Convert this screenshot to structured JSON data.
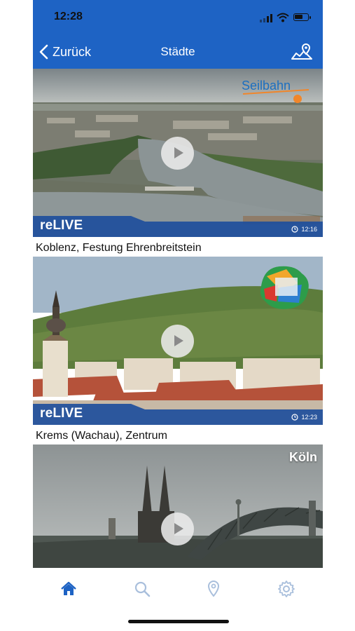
{
  "status_bar": {
    "time": "12:28"
  },
  "nav": {
    "back_label": "Zurück",
    "title": "Städte"
  },
  "colors": {
    "primary": "#1e63c4",
    "tab_inactive": "#a9bfdc"
  },
  "cams": [
    {
      "relive_label": "reLIVE",
      "time": "12:16",
      "caption": "Koblenz, Festung Ehrenbreitstein",
      "logo_text": "Seilbahn"
    },
    {
      "relive_label": "reLIVE",
      "time": "12:23",
      "caption": "Krems (Wachau), Zentrum"
    },
    {
      "city_label": "Köln"
    }
  ],
  "tabs": [
    {
      "icon": "home-icon",
      "active": true
    },
    {
      "icon": "search-icon",
      "active": false
    },
    {
      "icon": "location-pin-icon",
      "active": false
    },
    {
      "icon": "gear-icon",
      "active": false
    }
  ]
}
